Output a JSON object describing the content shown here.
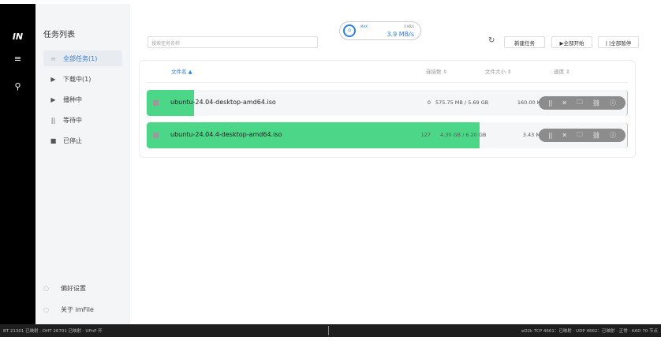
{
  "rail": {
    "logo": "IN",
    "menu_icon": "≡",
    "search_icon": "⚲"
  },
  "sidebar": {
    "title": "任务列表",
    "items": [
      {
        "label": "全部任务(1)",
        "icon": "≡"
      },
      {
        "label": "下载中(1)",
        "icon": "▶"
      },
      {
        "label": "播种中",
        "icon": "▶"
      },
      {
        "label": "等待中",
        "icon": "||"
      },
      {
        "label": "已停止",
        "icon": "■"
      }
    ],
    "bottom": [
      {
        "label": "偏好设置",
        "icon": "○"
      },
      {
        "label": "关于 imFile",
        "icon": "○"
      }
    ]
  },
  "search": {
    "placeholder": "搜索任务名称"
  },
  "speed": {
    "max": "MAX",
    "upload": "0 KB/s",
    "download": "3.9 MB/s"
  },
  "toolbar": {
    "refresh": "↻",
    "new_task": "新建任务",
    "start_all": "▶全部开始",
    "pause_all": "| |全部暂停"
  },
  "table": {
    "headers": {
      "name": "文件名 ▲",
      "connections": "连接数 ⇕",
      "size": "文件大小 ⇕",
      "speed": "速度 ⇕"
    },
    "rows": [
      {
        "name": "ubuntu-24.04-desktop-amd64.iso",
        "connections": "0",
        "size": "575.75 MB / 5.69 GB",
        "speed": "160.00 KB/s",
        "progress": 0.0988
      },
      {
        "name": "ubuntu-24.04.4-desktop-amd64.iso",
        "connections": "127",
        "size": "4.30 GB / 6.20 GB",
        "speed": "3.43 MB/s",
        "progress": 0.6935
      }
    ],
    "actions": [
      "||",
      "✕",
      "🗀",
      "⛓",
      "ⓘ"
    ]
  },
  "statusbar": {
    "left": "BT 21301 已映射 · DHT 26701 已映射 · UPnP 开",
    "right": "eD2k TCP 4661：已映射 · UDP 4662：已映射 · 正常 · KAD 70 节点"
  },
  "colors": {
    "accent": "#2d7ee8",
    "progress": "#4cd687"
  }
}
